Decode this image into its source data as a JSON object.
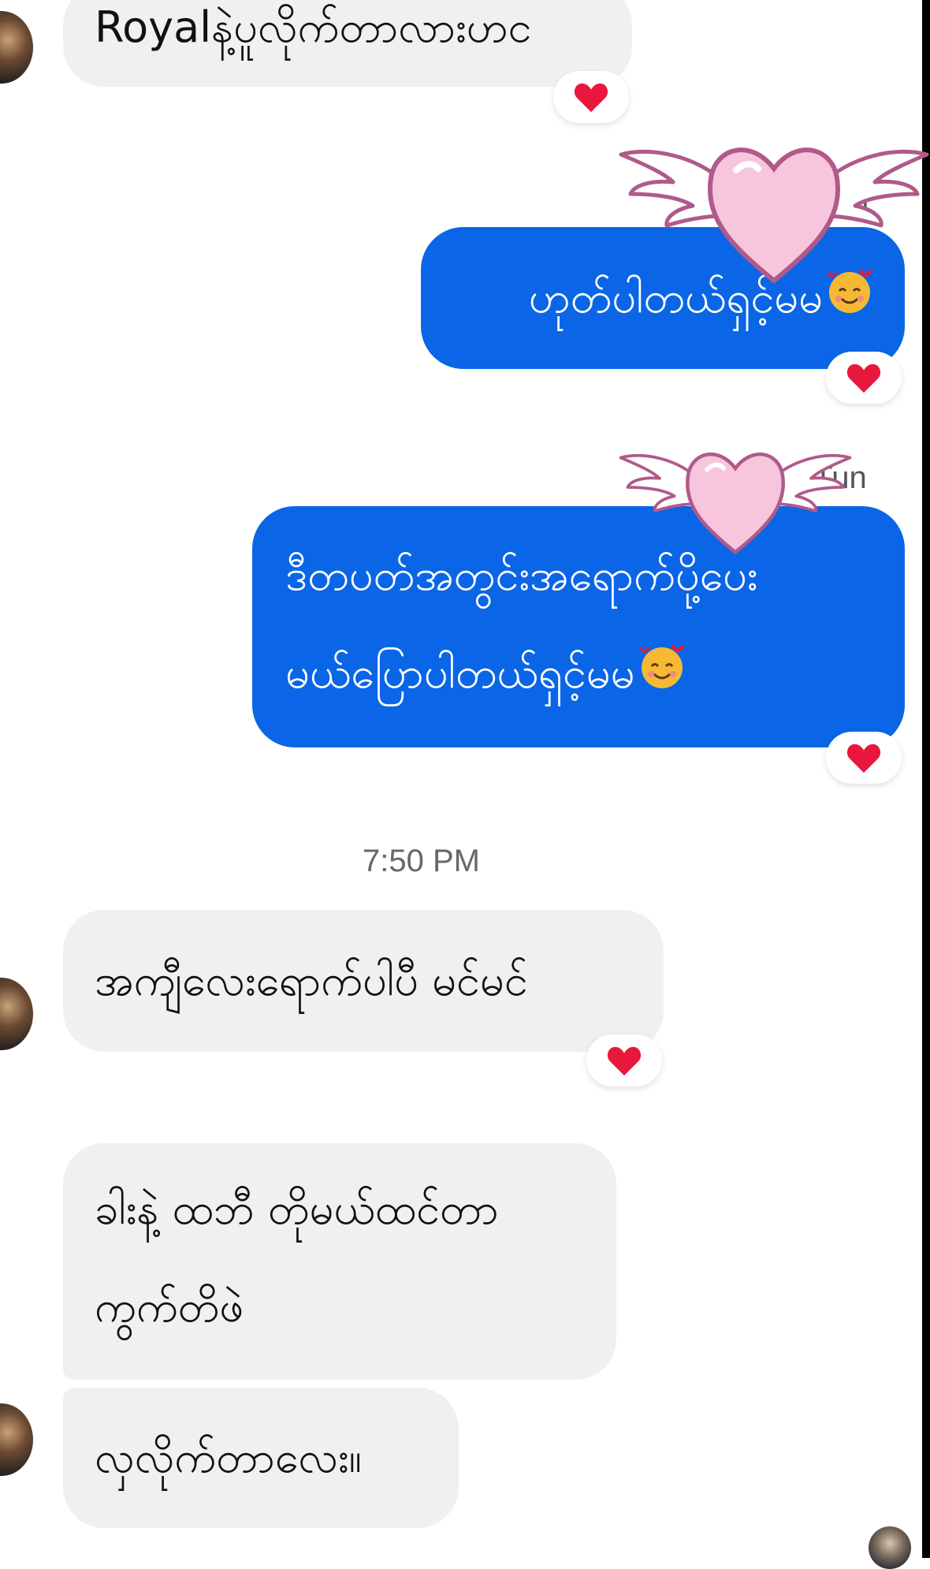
{
  "messages": {
    "m1": {
      "text": "Royalနဲ့ပူလိုက်တာလားဟင",
      "reaction": "heart"
    },
    "m2": {
      "text": "ဟုတ်ပါတယ်ရှင့်မမ",
      "emoji": "smiling-face-with-hearts",
      "reaction": "heart"
    },
    "m3": {
      "line1": "ဒီတပတ်အတွင်းအရောက်ပို့ပေး",
      "line2": "မယ်ပြောပါတယ်ရှင့်မမ",
      "emoji": "smiling-face-with-hearts",
      "reaction": "heart"
    },
    "m4": {
      "text": "အကျီလေးရောက်ပါပီ မင်မင်",
      "reaction": "heart"
    },
    "m5": {
      "line1": "ခါးနဲ့ ထဘီ တိုမယ်ထင်တာ",
      "line2": "ကွက်တိဖဲ"
    },
    "m6": {
      "text": "လှလိုက်တာလေး။"
    }
  },
  "sender_labels": {
    "label1": "A",
    "label1_end": "n",
    "label2": "eTun"
  },
  "timestamp": "7:50 PM",
  "colors": {
    "outgoing": "#0a66e6",
    "incoming": "#f0f0f2",
    "heart": "#e8183c",
    "sticker": "#f7c6dd"
  }
}
